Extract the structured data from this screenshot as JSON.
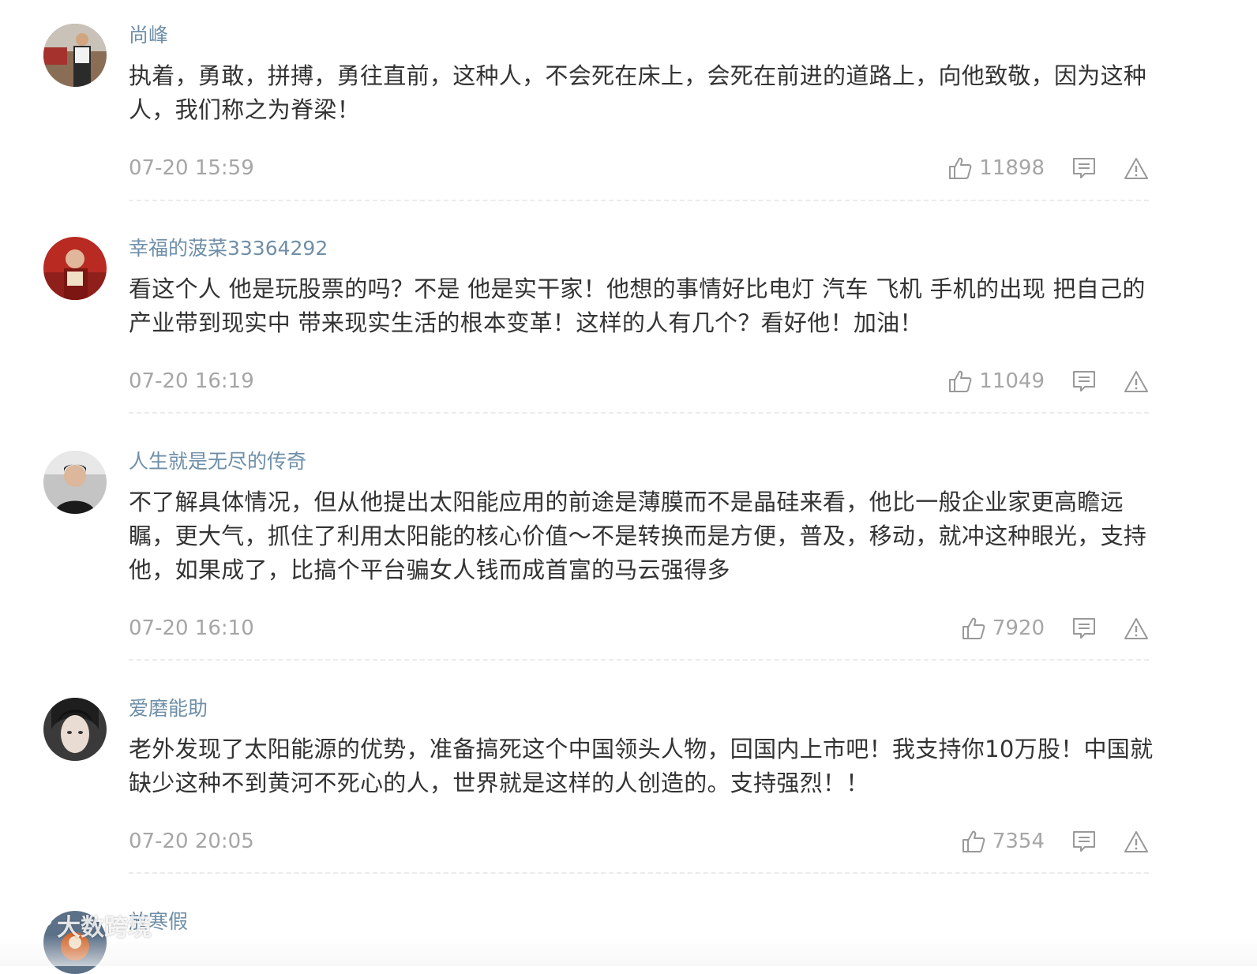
{
  "comments": [
    {
      "username": "尚峰",
      "text": "执着，勇敢，拼搏，勇往直前，这种人，不会死在床上，会死在前进的道路上，向他致敬，因为这种人，我们称之为脊梁！",
      "time": "07-20 15:59",
      "likes": "11898"
    },
    {
      "username": "幸福的菠菜33364292",
      "text": "看这个人 他是玩股票的吗？不是 他是实干家！他想的事情好比电灯 汽车 飞机 手机的出现 把自己的产业带到现实中 带来现实生活的根本变革！这样的人有几个？看好他！加油！",
      "time": "07-20 16:19",
      "likes": "11049"
    },
    {
      "username": "人生就是无尽的传奇",
      "text": "不了解具体情况，但从他提出太阳能应用的前途是薄膜而不是晶硅来看，他比一般企业家更高瞻远瞩，更大气，抓住了利用太阳能的核心价值～不是转换而是方便，普及，移动，就冲这种眼光，支持他，如果成了，比搞个平台骗女人钱而成首富的马云强得多",
      "time": "07-20 16:10",
      "likes": "7920"
    },
    {
      "username": "爱磨能助",
      "text": "老外发现了太阳能源的优势，准备搞死这个中国领头人物，回国内上市吧！我支持你10万股！中国就缺少这种不到黄河不死心的人，世界就是这样的人创造的。支持强烈！！",
      "time": "07-20 20:05",
      "likes": "7354"
    },
    {
      "username": "放寒假"
    }
  ],
  "watermark": {
    "text": "大数跨境"
  },
  "icons": {
    "like": "thumbs-up-icon",
    "reply": "comment-icon",
    "report": "warning-icon"
  },
  "colors": {
    "username": "#6f8fa8",
    "text": "#333333",
    "meta": "#a6a6a6",
    "divider": "#ececec"
  }
}
